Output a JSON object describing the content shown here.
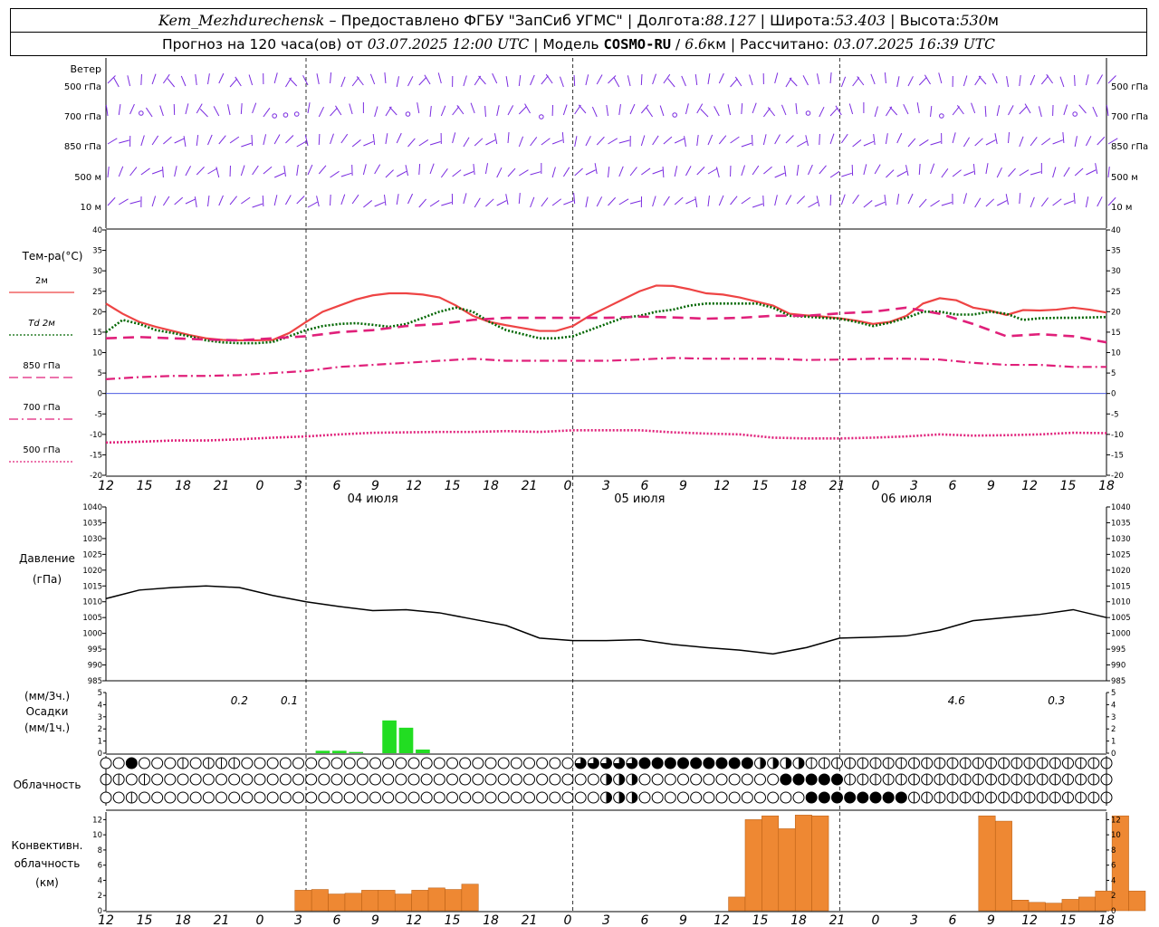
{
  "header": {
    "station": "Kem_Mezhdurechensk",
    "dash": " – ",
    "provider": "Предоставлено ФГБУ \"ЗапСиб УГМС\"",
    "lon_label": "Долгота:",
    "lon_value": "88.127",
    "lat_label": "Широта:",
    "lat_value": "53.403",
    "alt_label": "Высота:",
    "alt_value": "530",
    "alt_unit": "м",
    "sep": " | ",
    "forecast_text": "Прогноз на 120 часа(ов) от ",
    "forecast_date": "03.07.2025 12:00 UTC",
    "model_label": "Модель ",
    "model_name": "COSMO-RU",
    "model_res_sep": " / ",
    "model_res": "6.6",
    "model_res_unit": "км",
    "calc_label": "Рассчитано: ",
    "calc_date": "03.07.2025 16:39 UTC"
  },
  "wind_panel": {
    "title": "Ветер",
    "levels": [
      "500 гПа",
      "700 гПа",
      "850 гПа",
      "500 м",
      "10 м"
    ]
  },
  "temp_panel": {
    "title": "Тем-ра(°C)",
    "legend": [
      {
        "label": "2м",
        "color": "#ee4444",
        "style": "solid"
      },
      {
        "label": "Td  2м",
        "color": "#006600",
        "style": "dotted"
      },
      {
        "label": "850 гПа",
        "color": "#e0207a",
        "style": "dashed"
      },
      {
        "label": "700 гПа",
        "color": "#e0207a",
        "style": "dashdot"
      },
      {
        "label": "500 гПа",
        "color": "#e0207a",
        "style": "dotted"
      }
    ],
    "ticks": [
      40,
      35,
      30,
      25,
      20,
      15,
      10,
      5,
      0,
      -5,
      -10,
      -15,
      -20
    ]
  },
  "x_axis": {
    "hour_labels": [
      "12",
      "15",
      "18",
      "21",
      "0",
      "3",
      "6",
      "9",
      "12",
      "15",
      "18",
      "21",
      "0",
      "3",
      "6",
      "9",
      "12",
      "15",
      "18",
      "21",
      "0",
      "3",
      "6",
      "9",
      "12",
      "15",
      "18"
    ],
    "date_labels": [
      "04 июля",
      "05 июля",
      "06 июля"
    ]
  },
  "pressure_panel": {
    "title": "Давление",
    "unit": "(гПа)",
    "ticks": [
      1040,
      1035,
      1030,
      1025,
      1020,
      1015,
      1010,
      1005,
      1000,
      995,
      990,
      985
    ]
  },
  "precip_panel": {
    "unit1": "(мм/3ч.)",
    "title": "Осадки",
    "unit2": "(мм/1ч.)",
    "ticks": [
      5,
      4,
      3,
      2,
      1,
      0
    ],
    "totals": [
      {
        "h": 8,
        "text": "0.2"
      },
      {
        "h": 11,
        "text": "0.1"
      },
      {
        "h": 51,
        "text": "4.6"
      },
      {
        "h": 57,
        "text": "0.3"
      }
    ]
  },
  "cloud_panel": {
    "title": "Облачность"
  },
  "conv_panel": {
    "title1": "Конвективн.",
    "title2": "облачность",
    "unit": "(км)",
    "ticks": [
      12,
      10,
      8,
      6,
      4,
      2,
      0
    ]
  },
  "chart_data": [
    {
      "type": "line",
      "title": "Тем-ра(°C)",
      "x_unit": "hours from 03.07.2025 12:00 UTC",
      "ylim": [
        -20,
        40
      ],
      "series": [
        {
          "name": "2м",
          "x": [
            0,
            3,
            6,
            9,
            12,
            15,
            18,
            21,
            24,
            27,
            30,
            33,
            36,
            39,
            42,
            45,
            48,
            51,
            54,
            57,
            60,
            63,
            66,
            69,
            72,
            75,
            78,
            81,
            84,
            87,
            90,
            93,
            96,
            99,
            102,
            105,
            108,
            111,
            114,
            117,
            120,
            123,
            126,
            129,
            132,
            135,
            138,
            141,
            144,
            147,
            150,
            153,
            156,
            159,
            162,
            165,
            168,
            171,
            174,
            177,
            180
          ],
          "values": [
            22,
            19.5,
            17.5,
            16.3,
            15.3,
            14.3,
            13.5,
            13.1,
            13,
            13,
            13.1,
            14.8,
            17.5,
            20,
            21.5,
            23,
            24,
            24.5,
            24.5,
            24.2,
            23.5,
            21.5,
            19,
            17.5,
            16.7,
            16,
            15.3,
            15.3,
            16.5,
            19,
            21,
            23,
            25,
            26.4,
            26.3,
            25.5,
            24.5,
            24.2,
            23.5,
            22.5,
            21.5,
            19.5,
            19.1,
            18.8,
            18.4,
            17.8,
            17,
            17.5,
            19,
            22,
            23.3,
            22.8,
            21,
            20.3,
            19.2,
            20.4,
            20.3,
            20.5,
            21,
            20.5,
            19.8
          ]
        },
        {
          "name": "Td  2м",
          "x": [
            0,
            3,
            6,
            9,
            12,
            15,
            18,
            21,
            24,
            27,
            30,
            33,
            36,
            39,
            42,
            45,
            48,
            51,
            54,
            57,
            60,
            63,
            66,
            69,
            72,
            75,
            78,
            81,
            84,
            87,
            90,
            93,
            96,
            99,
            102,
            105,
            108,
            111,
            114,
            117,
            120,
            123,
            126,
            129,
            132,
            135,
            138,
            141,
            144,
            147,
            150,
            153,
            156,
            159,
            162,
            165,
            168,
            171,
            174,
            177,
            180
          ],
          "values": [
            15,
            18,
            17,
            15.5,
            14.8,
            14,
            13,
            12.5,
            12.3,
            12.3,
            12.6,
            14,
            15.5,
            16.5,
            17,
            17.2,
            16.8,
            16.3,
            17,
            18.5,
            20,
            21,
            20,
            17.5,
            15.5,
            14.5,
            13.5,
            13.5,
            14,
            15.5,
            17,
            18.5,
            19,
            20,
            20.5,
            21.5,
            22,
            22,
            22,
            22,
            21,
            19,
            18.8,
            18.5,
            18.3,
            17.5,
            16.5,
            17.3,
            18.5,
            20,
            20,
            19.3,
            19.3,
            20,
            19.5,
            18,
            18.4,
            18.5,
            18.5,
            18.6,
            18.7
          ]
        },
        {
          "name": "850 гПа",
          "x": [
            0,
            6,
            12,
            18,
            24,
            30,
            36,
            42,
            48,
            54,
            60,
            66,
            72,
            78,
            84,
            90,
            96,
            102,
            108,
            114,
            120,
            126,
            132,
            138,
            144,
            150,
            156,
            162,
            168,
            174,
            180
          ],
          "values": [
            13.5,
            13.8,
            13.5,
            13.2,
            13,
            13.5,
            14,
            15,
            15.5,
            16.5,
            17,
            18,
            18.5,
            18.5,
            18.5,
            18.5,
            18.8,
            18.6,
            18.3,
            18.5,
            19,
            19,
            19.6,
            20,
            21,
            19.5,
            17,
            14,
            14.5,
            14,
            12.5
          ]
        },
        {
          "name": "700 гПа",
          "x": [
            0,
            6,
            12,
            18,
            24,
            30,
            36,
            42,
            48,
            54,
            60,
            66,
            72,
            78,
            84,
            90,
            96,
            102,
            108,
            114,
            120,
            126,
            132,
            138,
            144,
            150,
            156,
            162,
            168,
            174,
            180
          ],
          "values": [
            3.5,
            4,
            4.3,
            4.3,
            4.5,
            5,
            5.5,
            6.5,
            7,
            7.5,
            8,
            8.5,
            8,
            8,
            8,
            8,
            8.3,
            8.7,
            8.5,
            8.5,
            8.5,
            8.2,
            8.3,
            8.5,
            8.5,
            8.3,
            7.5,
            7,
            7,
            6.5,
            6.5
          ]
        },
        {
          "name": "500 гПа",
          "x": [
            0,
            6,
            12,
            18,
            24,
            30,
            36,
            42,
            48,
            54,
            60,
            66,
            72,
            78,
            84,
            90,
            96,
            102,
            108,
            114,
            120,
            126,
            132,
            138,
            144,
            150,
            156,
            162,
            168,
            174,
            180
          ],
          "values": [
            -12,
            -11.8,
            -11.5,
            -11.5,
            -11.2,
            -10.8,
            -10.5,
            -10,
            -9.6,
            -9.5,
            -9.4,
            -9.4,
            -9.2,
            -9.4,
            -9,
            -9,
            -9,
            -9.5,
            -9.8,
            -10,
            -10.8,
            -11,
            -11,
            -10.8,
            -10.5,
            -10,
            -10.3,
            -10.2,
            -10,
            -9.6,
            -9.7
          ]
        }
      ]
    },
    {
      "type": "line",
      "title": "Давление",
      "x_unit": "hours from 03.07.2025 12:00 UTC",
      "ylim": [
        985,
        1040
      ],
      "series": [
        {
          "name": "Давление",
          "x": [
            0,
            6,
            12,
            18,
            24,
            30,
            36,
            42,
            48,
            54,
            60,
            66,
            72,
            78,
            84,
            90,
            96,
            102,
            108,
            114,
            120,
            126,
            132,
            138,
            144,
            150,
            156,
            162,
            168,
            174,
            180
          ],
          "values": [
            1011,
            1013.7,
            1014.5,
            1015,
            1014.5,
            1012,
            1010,
            1008.5,
            1007.2,
            1007.5,
            1006.5,
            1004.5,
            1002.5,
            998.5,
            997.7,
            997.7,
            998,
            996.5,
            995.5,
            994.7,
            993.5,
            995.5,
            998.5,
            998.8,
            999.2,
            1001,
            1004,
            1005,
            1006,
            1007.5,
            1005
          ]
        }
      ]
    },
    {
      "type": "bar",
      "title": "Осадки",
      "x_unit": "hours from 03.07.2025 12:00 UTC",
      "ylim": [
        0,
        5
      ],
      "series": [
        {
          "name": "Осадки",
          "x": [
            39,
            42,
            45,
            48,
            51,
            54,
            57,
            60
          ],
          "values": [
            0.2,
            0.2,
            0.1,
            0,
            2.7,
            2.1,
            0.3,
            0
          ]
        }
      ]
    },
    {
      "type": "bar",
      "title": "Конвективн. облачность",
      "x_unit": "hours from 03.07.2025 12:00 UTC",
      "ylim": [
        0,
        13
      ],
      "series": [
        {
          "name": "Конвективн. облачность",
          "x": [
            14,
            15,
            16,
            17,
            18,
            19,
            20,
            21,
            22,
            23,
            24,
            25,
            26,
            27,
            28,
            29,
            30,
            31,
            32,
            33,
            34,
            35,
            36,
            37,
            38,
            39,
            40,
            41,
            42,
            43,
            44,
            45
          ],
          "values": [
            2.7,
            2.8,
            2.2,
            2.3,
            2.7,
            2.7,
            2.2,
            2.7,
            3.0,
            3.0,
            3.5,
            3.5,
            3.5,
            0,
            0,
            0,
            0,
            0,
            0,
            0,
            0,
            0,
            0,
            0,
            0,
            0,
            0,
            0,
            0,
            0,
            0,
            0
          ]
        }
      ]
    }
  ]
}
